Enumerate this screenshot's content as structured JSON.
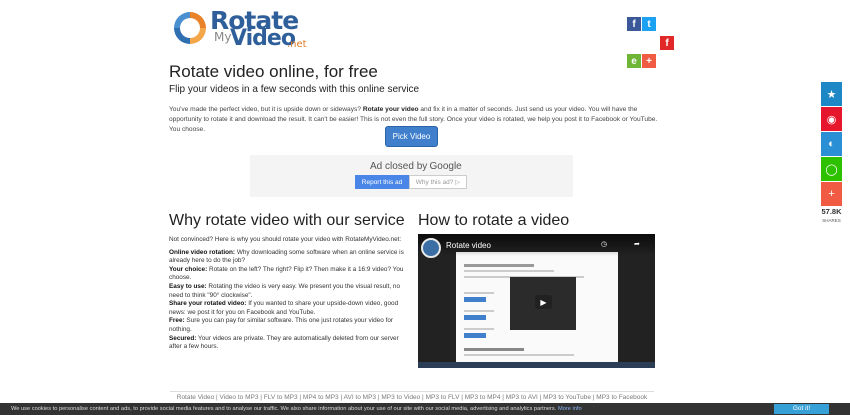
{
  "logo": {
    "word1": "Rotate",
    "word2": "My",
    "word3": "Video",
    "word4": ".net"
  },
  "social_top": [
    {
      "icon": "facebook-icon",
      "glyph": "f",
      "color": "#3b5998"
    },
    {
      "icon": "twitter-icon",
      "glyph": "t",
      "color": "#1da1f2"
    },
    {
      "icon": "flipboard-icon",
      "glyph": "f",
      "color": "#e12828"
    },
    {
      "icon": "evernote-icon",
      "glyph": "e",
      "color": "#6fb536"
    },
    {
      "icon": "plus-icon",
      "glyph": "+",
      "color": "#f15a43"
    }
  ],
  "header": {
    "title": "Rotate video online, for free",
    "subtitle": "Flip your videos in a few seconds with this online service"
  },
  "intro": {
    "part1": "You've made the perfect video, but it is upside down or sideways? ",
    "bold": "Rotate your video",
    "part2": " and fix it in a matter of seconds. Just send us your video. You will have the opportunity to rotate it and download the result. It can't be easier! This is not even the full story. Once your video is rotated, we help you post it to Facebook or YouTube. You choose."
  },
  "pick_button": "Pick Video",
  "ad": {
    "closed_by": "Ad closed by",
    "google": "Google",
    "report": "Report this ad",
    "why": "Why this ad? ▷"
  },
  "why_section": {
    "heading": "Why rotate video with our service",
    "lead": "Not convinced? Here is why you should rotate your video with RotateMyVideo.net:",
    "items": [
      {
        "label": "Online video rotation:",
        "text": " Why downloading some software when an online service is already here to do the job?"
      },
      {
        "label": "Your choice:",
        "text": " Rotate on the left? The right? Flip it? Then make it a 16:9 video? You choose."
      },
      {
        "label": "Easy to use:",
        "text": " Rotating the video is very easy. We present you the visual result, no need to think \"90° clockwise\"."
      },
      {
        "label": "Share your rotated video:",
        "text": " If you wanted to share your upside-down video, good news: we post it for you on Facebook and YouTube."
      },
      {
        "label": "Free:",
        "text": " Sure you can pay for similar software. This one just rotates your video for nothing."
      },
      {
        "label": "Secured:",
        "text": " Your videos are private. They are automatically deleted from our server after a few hours."
      }
    ]
  },
  "how_section": {
    "heading": "How to rotate a video",
    "video_title": "Rotate video"
  },
  "right_bar": {
    "buttons": [
      {
        "icon": "star-icon",
        "glyph": "★",
        "color": "#1e88c7"
      },
      {
        "icon": "weibo-icon",
        "glyph": "◉",
        "color": "#e6162d"
      },
      {
        "icon": "tencent-icon",
        "glyph": "◐",
        "color": "#2b8fd6"
      },
      {
        "icon": "wechat-icon",
        "glyph": "◯",
        "color": "#2dc100"
      },
      {
        "icon": "plus-icon",
        "glyph": "+",
        "color": "#f15a43"
      }
    ],
    "count": "57.8K",
    "count_label": "SHARES"
  },
  "footer_links": [
    "Rotate Video",
    "Video to MP3",
    "FLV to MP3",
    "MP4 to MP3",
    "AVI to MP3",
    "MP3 to Video",
    "MP3 to FLV",
    "MP3 to MP4",
    "MP3 to AVI",
    "MP3 to YouTube",
    "MP3 to Facebook"
  ],
  "cookie": {
    "text": "We use cookies to personalise content and ads, to provide social media features and to analyse our traffic. We also share information about your use of our site with our social media, advertising and analytics partners.",
    "more": "More info",
    "button": "Got it!"
  }
}
